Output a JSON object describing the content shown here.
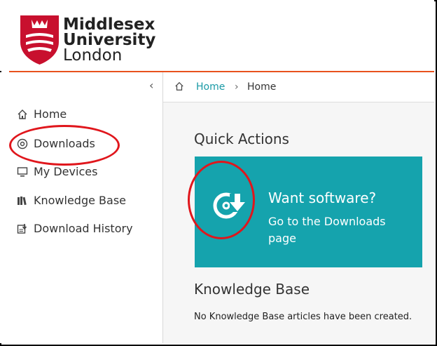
{
  "logo": {
    "line1": "Middlesex",
    "line2": "University",
    "line3": "London",
    "crest_color": "#c8102e"
  },
  "breadcrumb": {
    "home_icon": "home-icon",
    "link": "Home",
    "separator": "›",
    "current": "Home"
  },
  "sidebar": {
    "collapse_label": "‹",
    "items": [
      {
        "icon": "home-icon",
        "label": "Home"
      },
      {
        "icon": "disc-icon",
        "label": "Downloads"
      },
      {
        "icon": "monitor-icon",
        "label": "My Devices"
      },
      {
        "icon": "books-icon",
        "label": "Knowledge Base"
      },
      {
        "icon": "download-history-icon",
        "label": "Download History"
      }
    ]
  },
  "quick_actions": {
    "heading": "Quick Actions",
    "tile_title": "Want software?",
    "tile_subtitle": "Go to the Downloads page",
    "tile_color": "#15a3ad"
  },
  "knowledge_base": {
    "heading": "Knowledge Base",
    "empty_message": "No Knowledge Base articles have been created."
  },
  "colors": {
    "accent": "#e8521e",
    "link": "#1a9aa6",
    "annotation": "#e0161c"
  }
}
